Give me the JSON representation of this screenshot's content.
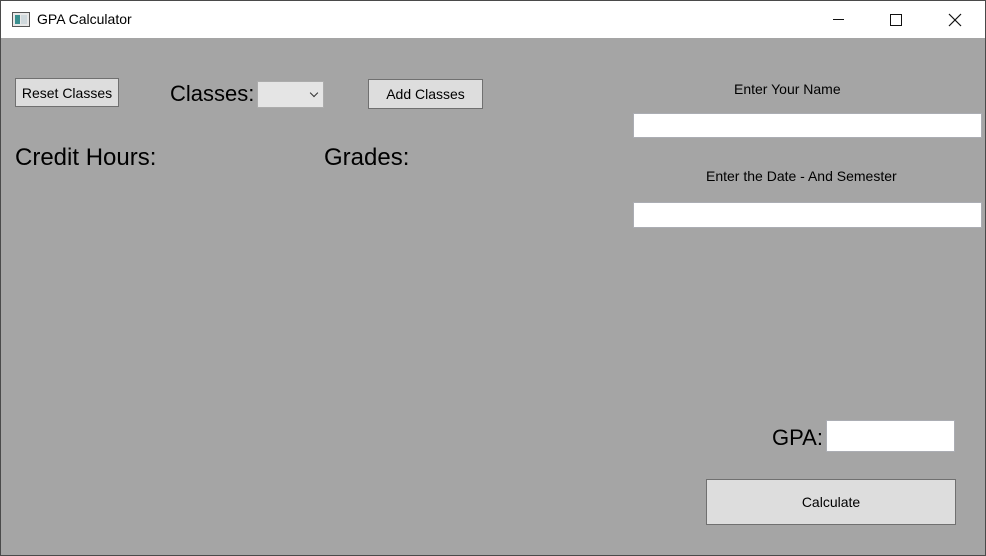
{
  "window": {
    "title": "GPA Calculator"
  },
  "controls": {
    "reset_label": "Reset Classes",
    "classes_label": "Classes:",
    "classes_selected": "",
    "add_label": "Add Classes",
    "credit_hours_label": "Credit Hours:",
    "grades_label": "Grades:",
    "name_label": "Enter Your Name",
    "name_value": "",
    "date_label": "Enter the Date - And Semester",
    "date_value": "",
    "gpa_label": "GPA:",
    "gpa_value": "",
    "calculate_label": "Calculate"
  },
  "colors": {
    "background": "#a5a5a5",
    "button": "#dddddd",
    "titlebar": "#ffffff"
  }
}
